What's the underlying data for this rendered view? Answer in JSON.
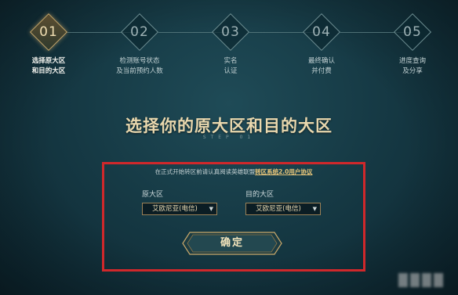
{
  "stepper": {
    "steps": [
      {
        "num": "01",
        "label_line1": "选择原大区",
        "label_line2": "和目的大区",
        "active": true
      },
      {
        "num": "02",
        "label_line1": "检测账号状态",
        "label_line2": "及当前预约人数",
        "active": false
      },
      {
        "num": "03",
        "label_line1": "实名",
        "label_line2": "认证",
        "active": false
      },
      {
        "num": "04",
        "label_line1": "最终确认",
        "label_line2": "并付费",
        "active": false
      },
      {
        "num": "05",
        "label_line1": "进度查询",
        "label_line2": "及分享",
        "active": false
      }
    ]
  },
  "page": {
    "title": "选择你的原大区和目的大区",
    "subtitle": "STEP 01"
  },
  "form": {
    "notice_prefix": "在正式开始转区前请认真阅读英雄联盟",
    "notice_link": "转区系统2.0用户协议",
    "origin_label": "原大区",
    "origin_value": "艾欧尼亚(电信)",
    "target_label": "目的大区",
    "target_value": "艾欧尼亚(电信)",
    "confirm_label": "确定"
  },
  "colors": {
    "accent_gold": "#c9a86a",
    "annotation_red": "#d0282b",
    "background": "#163a45"
  }
}
